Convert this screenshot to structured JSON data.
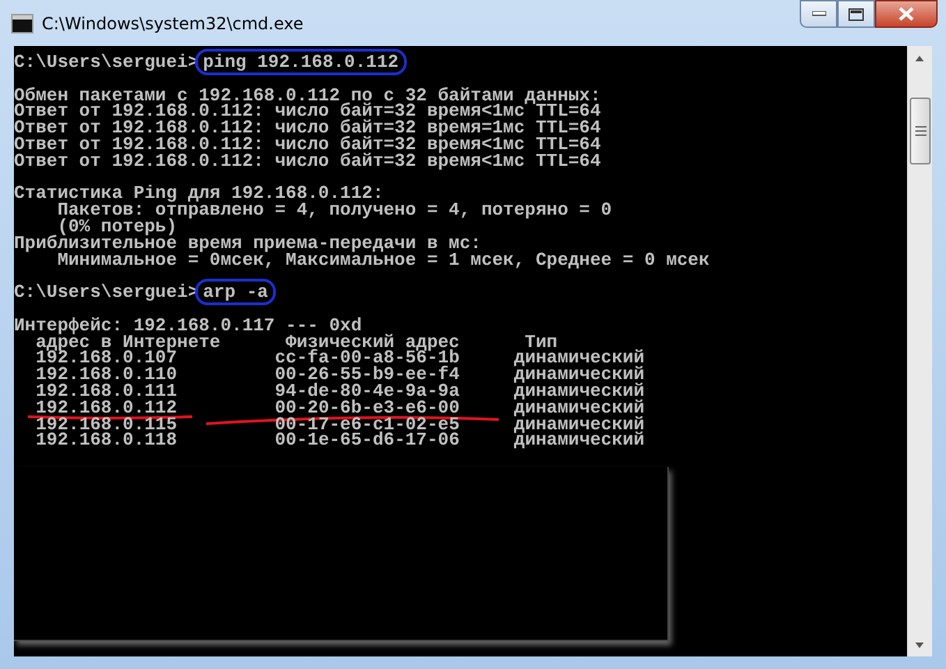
{
  "window": {
    "title": "C:\\Windows\\system32\\cmd.exe"
  },
  "console": {
    "lines": [
      {
        "kind": "prompt",
        "prompt": "C:\\Users\\serguei>",
        "command": "ping 192.168.0.112",
        "circled": true
      },
      {
        "kind": "blank"
      },
      {
        "kind": "text",
        "text": "Обмен пакетами с 192.168.0.112 по с 32 байтами данных:"
      },
      {
        "kind": "text",
        "text": "Ответ от 192.168.0.112: число байт=32 время<1мс TTL=64"
      },
      {
        "kind": "text",
        "text": "Ответ от 192.168.0.112: число байт=32 время=1мс TTL=64"
      },
      {
        "kind": "text",
        "text": "Ответ от 192.168.0.112: число байт=32 время<1мс TTL=64"
      },
      {
        "kind": "text",
        "text": "Ответ от 192.168.0.112: число байт=32 время<1мс TTL=64"
      },
      {
        "kind": "blank"
      },
      {
        "kind": "text",
        "text": "Статистика Ping для 192.168.0.112:"
      },
      {
        "kind": "text",
        "text": "    Пакетов: отправлено = 4, получено = 4, потеряно = 0"
      },
      {
        "kind": "text",
        "text": "    (0% потерь)"
      },
      {
        "kind": "text",
        "text": "Приблизительное время приема-передачи в мс:"
      },
      {
        "kind": "text",
        "text": "    Минимальное = 0мсек, Максимальное = 1 мсек, Среднее = 0 мсек"
      },
      {
        "kind": "blank"
      },
      {
        "kind": "prompt",
        "prompt": "C:\\Users\\serguei>",
        "command": "arp -a",
        "circled": true
      },
      {
        "kind": "blank"
      },
      {
        "kind": "text",
        "text": "Интерфейс: 192.168.0.117 --- 0xd"
      },
      {
        "kind": "text",
        "text": "  адрес в Интернете      Физический адрес      Тип"
      },
      {
        "kind": "arp_row",
        "ip": "192.168.0.107",
        "mac": "cc-fa-00-a8-56-1b",
        "type": "динамический",
        "pen_mark": false
      },
      {
        "kind": "arp_row",
        "ip": "192.168.0.110",
        "mac": "00-26-55-b9-ee-f4",
        "type": "динамический",
        "pen_mark": false
      },
      {
        "kind": "arp_row",
        "ip": "192.168.0.111",
        "mac": "94-de-80-4e-9a-9a",
        "type": "динамический",
        "pen_mark": false
      },
      {
        "kind": "arp_row",
        "ip": "192.168.0.112",
        "mac": "00-20-6b-e3-e6-00",
        "type": "динамический",
        "pen_mark": true
      },
      {
        "kind": "arp_row",
        "ip": "192.168.0.115",
        "mac": "00-17-e6-c1-02-e5",
        "type": "динамический",
        "pen_mark": false
      },
      {
        "kind": "arp_row",
        "ip": "192.168.0.118",
        "mac": "00-1e-65-d6-17-06",
        "type": "динамический",
        "pen_mark": false
      }
    ]
  }
}
